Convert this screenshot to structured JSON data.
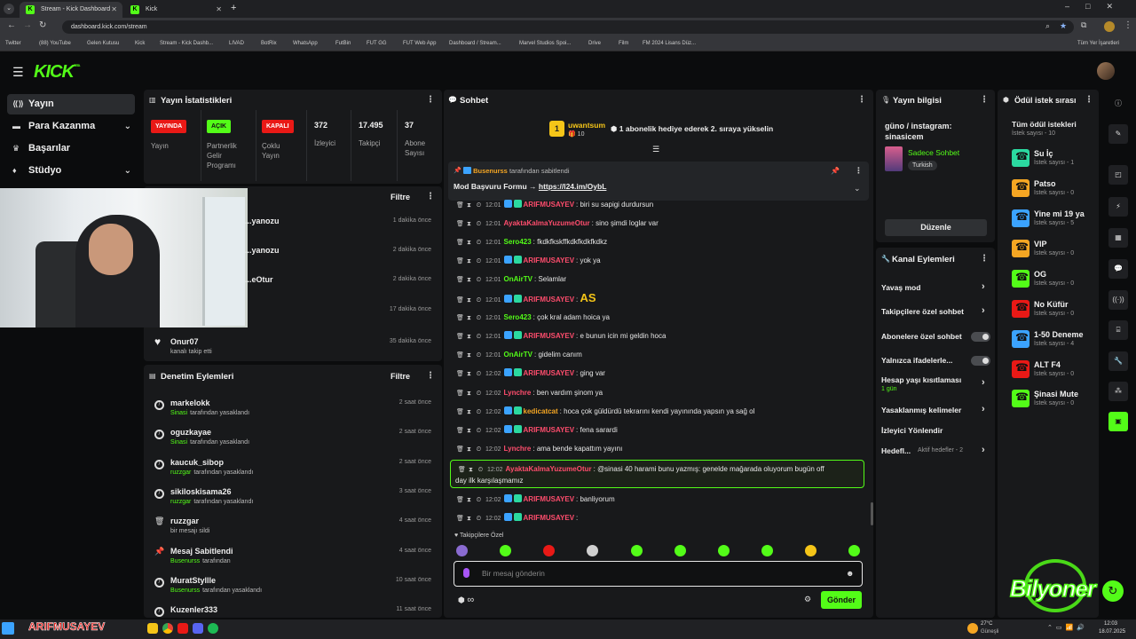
{
  "browser": {
    "tabs": [
      {
        "label": "Stream - Kick Dashboard",
        "close": "✕"
      },
      {
        "label": "Kick",
        "close": "✕"
      }
    ],
    "new_tab": "+",
    "url": "dashboard.kick.com/stream",
    "bookmarks": [
      "Twitter",
      "(88) YouTube",
      "Gelen Kutusu",
      "Kick",
      "Stream - Kick Dashb...",
      "LIVAD",
      "BotRix",
      "WhatsApp",
      "FutBin",
      "FUT GG",
      "FUT Web App",
      "Dashboard / Stream...",
      "Marvel Studios Spoi...",
      "Drive",
      "Film",
      "FM 2024 Lisans Düz..."
    ],
    "all_bookmarks": "Tüm Yer İşaretleri"
  },
  "app": {
    "logo": "KICK",
    "logo_beta": "BETA"
  },
  "sidebar": {
    "items": [
      {
        "label": "Yayın",
        "icon": "broadcast-icon"
      },
      {
        "label": "Para Kazanma",
        "icon": "money-icon"
      },
      {
        "label": "Başarılar",
        "icon": "trophy-icon"
      },
      {
        "label": "Stüdyo",
        "icon": "studio-icon"
      }
    ]
  },
  "stats": {
    "title": "Yayın İstatistikleri",
    "items": [
      {
        "badge": "YAYINDA",
        "label": "Yayın",
        "color": "#e91916"
      },
      {
        "badge": "AÇIK",
        "label": "Partnerlik\nGelir\nProgramı",
        "color": "#53fc18"
      },
      {
        "badge": "KAPALI",
        "label": "Çoklu\nYayın",
        "color": "#e91916"
      },
      {
        "value": "372",
        "label": "İzleyici"
      },
      {
        "value": "17.495",
        "label": "Takipçi"
      },
      {
        "value": "37",
        "label": "Abone\nSayısı"
      }
    ]
  },
  "activity": {
    "filter": "Filtre",
    "rows": [
      {
        "name": "...yanozu",
        "time": "1 dakika önce"
      },
      {
        "name": "...yanozu",
        "time": "2 dakika önce"
      },
      {
        "name": "...eOtur",
        "time": "2 dakika önce"
      },
      {
        "name": "",
        "time": "17 dakika önce"
      },
      {
        "name": "Onur07",
        "sub": "kanalı takip etti",
        "time": "35 dakika önce"
      }
    ]
  },
  "moderation": {
    "title": "Denetim Eylemleri",
    "filter": "Filtre",
    "rows": [
      {
        "name": "markelokk",
        "mod": "Sinasi",
        "action": "tarafından yasaklandı",
        "time": "2 saat önce"
      },
      {
        "name": "oguzkayae",
        "mod": "Sinasi",
        "action": "tarafından yasaklandı",
        "time": "2 saat önce"
      },
      {
        "name": "kaucuk_sibop",
        "mod": "ruzzgar",
        "action": "tarafından yasaklandı",
        "time": "2 saat önce"
      },
      {
        "name": "sikiloskisama26",
        "mod": "ruzzgar",
        "action": "tarafından yasaklandı",
        "time": "3 saat önce"
      },
      {
        "name": "ruzzgar",
        "mod": "",
        "action": "bir mesajı sildi",
        "time": "4 saat önce"
      },
      {
        "name": "Mesaj Sabitlendi",
        "mod": "Busenurss",
        "action": "tarafından",
        "time": "4 saat önce"
      },
      {
        "name": "MuratStyllle",
        "mod": "Busenurss",
        "action": "tarafından yasaklandı",
        "time": "10 saat önce"
      },
      {
        "name": "Kuzenler333",
        "mod": "",
        "action": "",
        "time": "11 saat önce"
      }
    ]
  },
  "chat": {
    "title": "Sohbet",
    "gift_user": "uwantsum",
    "gift_count": "10",
    "gift_text": "1 abonelik hediye ederek 2. sıraya yükselin",
    "pinned_by_user": "Busenurss",
    "pinned_by_text": "tarafından sabitlendi",
    "pinned_msg": "Mod Başvuru Formu → ",
    "pinned_link": "https://l24.im/OybL",
    "messages": [
      {
        "time": "12:01",
        "user": "ARIFMUSAYEV",
        "color": "#ff4d6d",
        "text": "biri su sapigi durdursun"
      },
      {
        "time": "12:01",
        "user": "AyaktaKalmaYuzumeOtur",
        "color": "#ff4d6d",
        "text": "sino şimdi loglar var"
      },
      {
        "time": "12:01",
        "user": "Sero423",
        "color": "#53fc18",
        "text": "fkdkfkskffkdkfkdkfkdkz"
      },
      {
        "time": "12:01",
        "user": "ARIFMUSAYEV",
        "color": "#ff4d6d",
        "text": "yok ya"
      },
      {
        "time": "12:01",
        "user": "OnAirTV",
        "color": "#53fc18",
        "text": "Selamlar"
      },
      {
        "time": "12:01",
        "user": "ARIFMUSAYEV",
        "color": "#ff4d6d",
        "text": "AS"
      },
      {
        "time": "12:01",
        "user": "Sero423",
        "color": "#53fc18",
        "text": "çok kral adam hoica ya"
      },
      {
        "time": "12:01",
        "user": "ARIFMUSAYEV",
        "color": "#ff4d6d",
        "text": "e bunun icin mi geldin hoca"
      },
      {
        "time": "12:01",
        "user": "OnAirTV",
        "color": "#53fc18",
        "text": "gidelim canım"
      },
      {
        "time": "12:02",
        "user": "ARIFMUSAYEV",
        "color": "#ff4d6d",
        "text": "ging var"
      },
      {
        "time": "12:02",
        "user": "Lynchre",
        "color": "#ff4d6d",
        "text": "ben vardım şinom ya"
      },
      {
        "time": "12:02",
        "user": "kedicatcat",
        "color": "#f5a623",
        "text": "hoca çok güldürdü tekrarını kendi yayınında yapsın ya sağ ol"
      },
      {
        "time": "12:02",
        "user": "ARIFMUSAYEV",
        "color": "#ff4d6d",
        "text": "fena sarardi"
      },
      {
        "time": "12:02",
        "user": "Lynchre",
        "color": "#ff4d6d",
        "text": "ama bende kapattım yayını"
      }
    ],
    "highlight": {
      "time": "12:02",
      "user": "AyaktaKalmaYuzumeOtur",
      "line1": "@sinasi 40 harami bunu yazmış: genelde mağarada oluyorum bugün off",
      "line2": "day ilk karşılaşmamız"
    },
    "messages2": [
      {
        "time": "12:02",
        "user": "ARIFMUSAYEV",
        "color": "#ff4d6d",
        "text": "banliyorum"
      },
      {
        "time": "12:02",
        "user": "ARIFMUSAYEV",
        "color": "#ff4d6d",
        "text": ""
      }
    ],
    "followers_only": "Takipçilere Özel",
    "input_placeholder": "Bir mesaj gönderin",
    "points": "∞",
    "send": "Gönder"
  },
  "stream_info": {
    "title": "Yayın bilgisi",
    "stream_title": "güno / instagram: sinasicem",
    "category": "Sadece Sohbet",
    "tag": "Turkish",
    "edit": "Düzenle"
  },
  "channel_actions": {
    "title": "Kanal Eylemleri",
    "items": [
      {
        "label": "Yavaş mod",
        "control": "chevron"
      },
      {
        "label": "Takipçilere özel sohbet",
        "control": "chevron"
      },
      {
        "label": "Abonelere özel sohbet",
        "control": "toggle"
      },
      {
        "label": "Yalnızca ifadelerle...",
        "control": "toggle"
      },
      {
        "label": "Hesap yaşı kısıtlaması",
        "sub": "1 gün",
        "control": "chevron"
      },
      {
        "label": "Yasaklanmış kelimeler",
        "control": "chevron"
      },
      {
        "label": "İzleyici Yönlendir",
        "control": "none"
      },
      {
        "label": "Hedefl...",
        "sub": "Aktif hedefler - 2",
        "control": "chevron"
      }
    ]
  },
  "rewards": {
    "title": "Ödül istek sırası",
    "all_title": "Tüm ödül istekleri",
    "all_sub": "İstek sayısı - 10",
    "items": [
      {
        "name": "Su İç",
        "sub": "İstek sayısı - 1",
        "color": "#2bd9a0"
      },
      {
        "name": "Patso",
        "sub": "İstek sayısı - 0",
        "color": "#f5a623"
      },
      {
        "name": "Yine mi 19 ya",
        "sub": "İstek sayısı - 5",
        "color": "#3ba3ff"
      },
      {
        "name": "VIP",
        "sub": "İstek sayısı - 0",
        "color": "#f5a623"
      },
      {
        "name": "OG",
        "sub": "İstek sayısı - 0",
        "color": "#53fc18"
      },
      {
        "name": "No Küfür",
        "sub": "İstek sayısı - 0",
        "color": "#e91916"
      },
      {
        "name": "1-50 Deneme",
        "sub": "İstek sayısı - 4",
        "color": "#3ba3ff"
      },
      {
        "name": "ALT F4",
        "sub": "İstek sayısı - 0",
        "color": "#e91916"
      },
      {
        "name": "Şinasi Mute",
        "sub": "İstek sayısı - 0",
        "color": "#53fc18"
      }
    ]
  },
  "overlay": {
    "watermark": "Bilyoner",
    "taskbar_user": "ARIFMUSAYEV",
    "weather_temp": "27°C",
    "weather_desc": "Güneşli",
    "clock_time": "12:03",
    "clock_date": "18.07.2025"
  },
  "colors": {
    "accent": "#53fc18",
    "live": "#e91916",
    "panel": "#18191b"
  }
}
